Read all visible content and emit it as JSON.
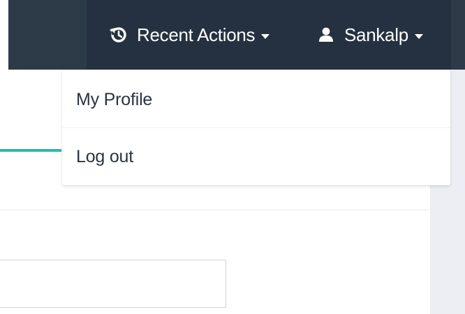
{
  "navbar": {
    "recent_actions_label": "Recent Actions",
    "user_label": "Sankalp",
    "recent_actions_icon": "history-icon",
    "user_icon": "user-icon",
    "caret_icon": "caret-down-icon"
  },
  "user_menu": {
    "items": [
      {
        "label": "My Profile"
      },
      {
        "label": "Log out"
      }
    ]
  },
  "colors": {
    "navbar_bg": "#2d3a48",
    "navbar_bg_active": "#253140",
    "accent_teal": "#1fbfae",
    "side_panel_bg": "#eceef3",
    "menu_text": "#2b3440"
  }
}
